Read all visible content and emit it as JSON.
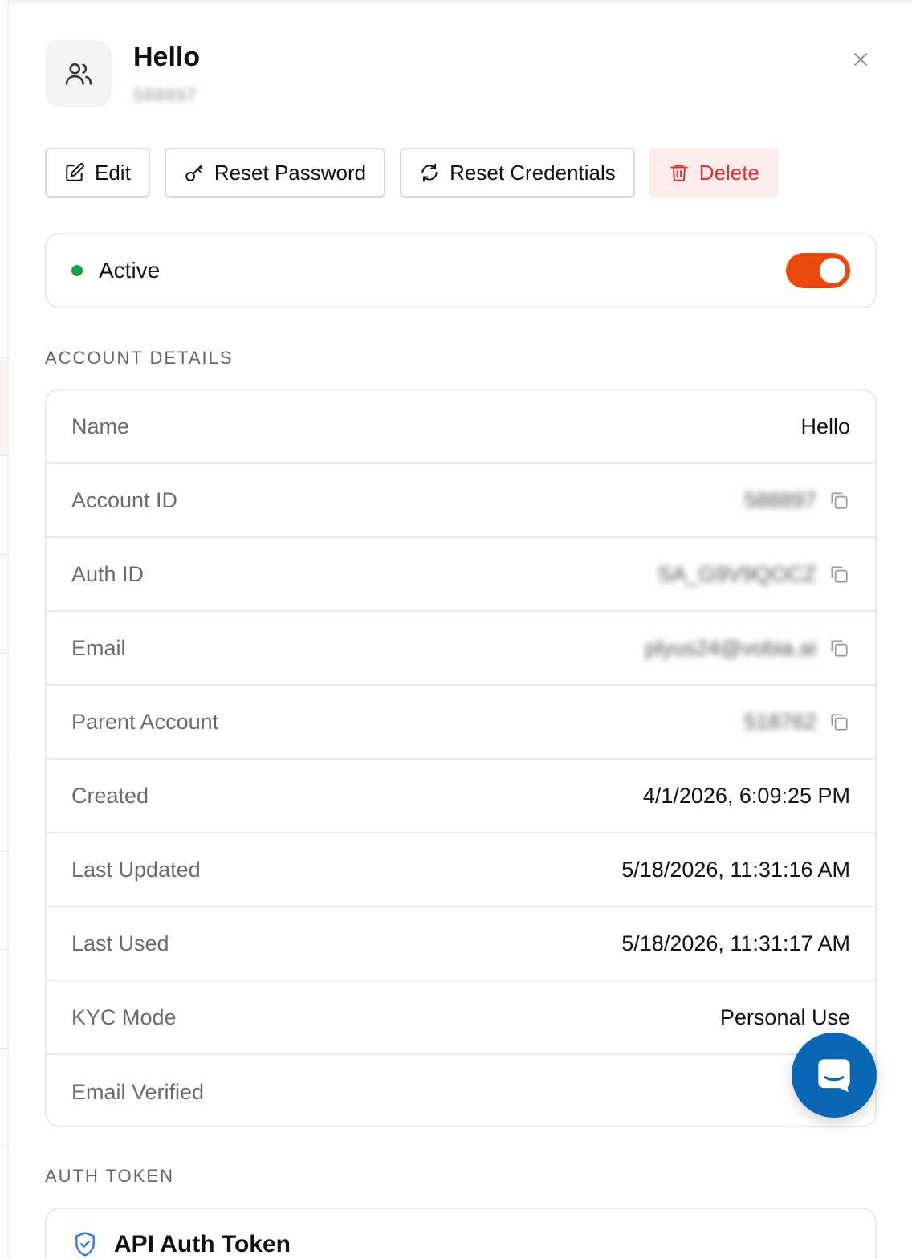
{
  "header": {
    "title": "Hello",
    "subtitle": "588897",
    "avatar_icon": "users-icon",
    "close_icon": "close-icon"
  },
  "actions": {
    "edit_label": "Edit",
    "reset_password_label": "Reset Password",
    "reset_credentials_label": "Reset Credentials",
    "delete_label": "Delete"
  },
  "status": {
    "label": "Active",
    "dot_color": "#16a34a",
    "toggle_on": true,
    "toggle_color": "#ea4a0c"
  },
  "account_details": {
    "section_title": "ACCOUNT DETAILS",
    "rows": [
      {
        "label": "Name",
        "value": "Hello"
      },
      {
        "label": "Account ID",
        "value": "588897"
      },
      {
        "label": "Auth ID",
        "value": "SA_G9V9QOCZ"
      },
      {
        "label": "Email",
        "value": "plyus24@vobia.ai"
      },
      {
        "label": "Parent Account",
        "value": "518762"
      },
      {
        "label": "Created",
        "value": "4/1/2026, 6:09:25 PM"
      },
      {
        "label": "Last Updated",
        "value": "5/18/2026, 11:31:16 AM"
      },
      {
        "label": "Last Used",
        "value": "5/18/2026, 11:31:17 AM"
      },
      {
        "label": "KYC Mode",
        "value": "Personal Use"
      },
      {
        "label": "Email Verified",
        "value": ""
      }
    ]
  },
  "auth_token": {
    "section_title": "AUTH TOKEN",
    "card_title": "API Auth Token",
    "icon": "shield-check-icon"
  },
  "chat": {
    "icon": "chat-icon",
    "color": "#0a67b5"
  }
}
